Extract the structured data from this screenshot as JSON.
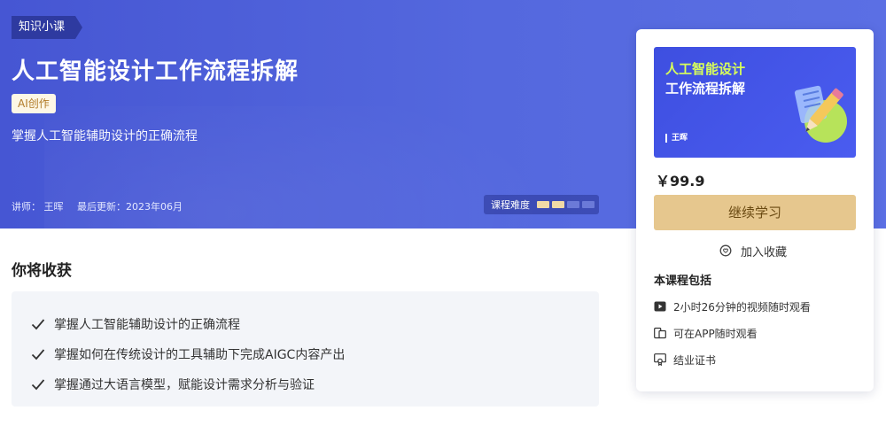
{
  "hero": {
    "category_tag": "知识小课",
    "title": "人工智能设计工作流程拆解",
    "badge": "AI创作",
    "subtitle": "掌握人工智能辅助设计的正确流程",
    "instructor": "讲师： 王晖",
    "updated": "最后更新：2023年06月",
    "difficulty_label": "课程难度",
    "difficulty_level": 2,
    "difficulty_max": 4
  },
  "gains": {
    "title": "你将收获",
    "items": [
      "掌握人工智能辅助设计的正确流程",
      "掌握如何在传统设计的工具辅助下完成AIGC内容产出",
      "掌握通过大语言模型，赋能设计需求分析与验证"
    ]
  },
  "card": {
    "cover_line1": "人工智能设计",
    "cover_line2": "工作流程拆解",
    "cover_author": "王晖",
    "price": "￥99.9",
    "continue_label": "继续学习",
    "favorite_label": "加入收藏",
    "includes_title": "本课程包括",
    "includes": [
      {
        "icon": "video-icon",
        "text": "2小时26分钟的视频随时观看"
      },
      {
        "icon": "devices-icon",
        "text": "可在APP随时观看"
      },
      {
        "icon": "certificate-icon",
        "text": "结业证书"
      }
    ]
  },
  "colors": {
    "hero_bg": "#4a5cd8",
    "accent_gold": "#e6c78e",
    "cover_title_highlight": "#d8ff5a"
  }
}
